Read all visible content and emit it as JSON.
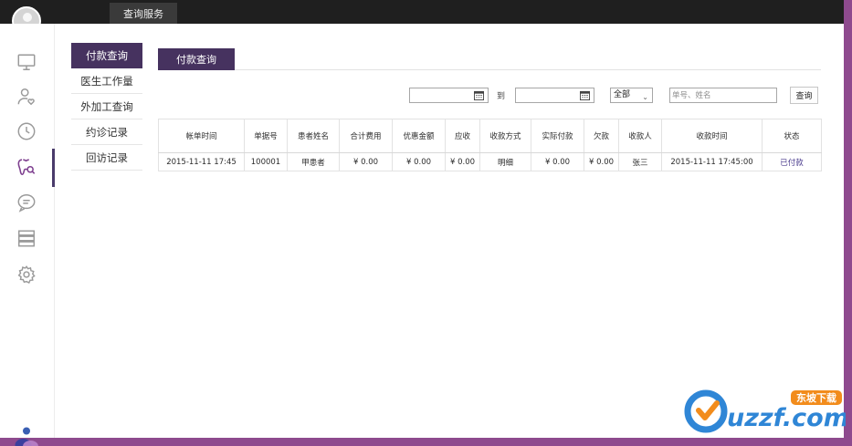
{
  "topbar": {
    "tab_label": "查询服务"
  },
  "subnav": [
    {
      "label": "付款查询"
    },
    {
      "label": "医生工作量"
    },
    {
      "label": "外加工查询"
    },
    {
      "label": "约诊记录"
    },
    {
      "label": "回访记录"
    }
  ],
  "rail_icons": [
    "monitor-icon",
    "user-heart-icon",
    "clock-icon",
    "tooth-search-icon",
    "chat-icon",
    "archive-icon",
    "gear-icon"
  ],
  "main": {
    "active_tab": "付款查询"
  },
  "filters": {
    "start_date": "",
    "to_label": "到",
    "end_date": "",
    "status_value": "全部",
    "search_placeholder": "单号、姓名",
    "query_label": "查询"
  },
  "table": {
    "columns": [
      "帐单时间",
      "单据号",
      "患者姓名",
      "合计费用",
      "优惠金额",
      "应收",
      "收款方式",
      "实际付款",
      "欠款",
      "收款人",
      "收款时间",
      "状态"
    ],
    "rows": [
      [
        "2015-11-11 17:45",
        "100001",
        "甲患者",
        "¥ 0.00",
        "¥ 0.00",
        "¥ 0.00",
        "明细",
        "¥ 0.00",
        "¥ 0.00",
        "张三",
        "2015-11-11 17:45:00",
        "已付款"
      ]
    ]
  },
  "watermark": {
    "text": "uzzf.com",
    "badge": "东坡下载"
  },
  "colors": {
    "accent": "#46325f",
    "topbar": "#1f1f1f",
    "desktop": "#8e4a8e",
    "paid_status": "#4a3b8c"
  }
}
